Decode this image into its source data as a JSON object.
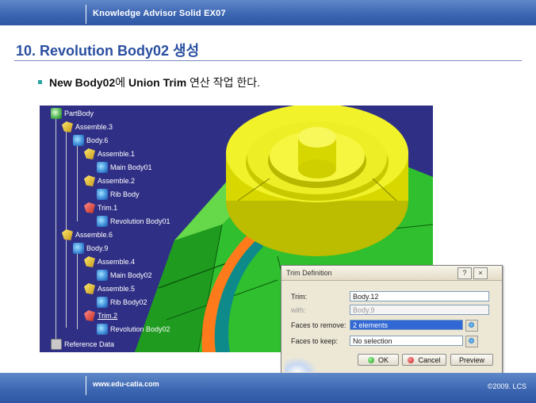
{
  "header": {
    "title": "Knowledge Advisor Solid  EX07"
  },
  "page": {
    "title": "10. Revolution Body02 생성",
    "bullet_bold": "New Body02",
    "bullet_mid": "에 ",
    "bullet_bold2": "Union Trim",
    "bullet_end": " 연산 작업 한다."
  },
  "tree": {
    "items": [
      {
        "label": "PartBody",
        "icon": "part-icon"
      },
      {
        "label": "Assemble.3",
        "icon": "assemble-icon"
      },
      {
        "label": "Body.6",
        "icon": "body-icon"
      },
      {
        "label": "Assemble.1",
        "icon": "assemble-icon"
      },
      {
        "label": "Main Body01",
        "icon": "body-icon"
      },
      {
        "label": "Assemble.2",
        "icon": "assemble-icon"
      },
      {
        "label": "Rib Body",
        "icon": "body-icon"
      },
      {
        "label": "Trim.1",
        "icon": "trim-icon"
      },
      {
        "label": "Revolution Body01",
        "icon": "body-icon"
      },
      {
        "label": "Assemble.6",
        "icon": "assemble-icon"
      },
      {
        "label": "Body.9",
        "icon": "body-icon"
      },
      {
        "label": "Assemble.4",
        "icon": "assemble-icon"
      },
      {
        "label": "Main Body02",
        "icon": "body-icon"
      },
      {
        "label": "Assemble.5",
        "icon": "assemble-icon"
      },
      {
        "label": "Rib Body02",
        "icon": "body-icon"
      },
      {
        "label": "Trim.2",
        "icon": "trim-icon"
      },
      {
        "label": "Revolution Body02",
        "icon": "body-icon"
      },
      {
        "label": "Reference Data",
        "icon": "reference-icon"
      }
    ]
  },
  "dialog": {
    "title": "Trim Definition",
    "help": "?",
    "close": "×",
    "trim_label": "Trim:",
    "trim_value": "Body.12",
    "with_label": "with:",
    "with_value": "Body.9",
    "remove_label": "Faces to remove:",
    "remove_value": "2 elements",
    "keep_label": "Faces to keep:",
    "keep_value": "No selection",
    "ok": "OK",
    "cancel": "Cancel",
    "preview": "Preview"
  },
  "footer": {
    "site": "www.edu-catia.com",
    "copyright": "©2009. LCS"
  },
  "colors": {
    "header": "#3d67b2",
    "title": "#2a4fa0",
    "viewport": "#2f2f86",
    "bullet": "#2aa3a3"
  }
}
